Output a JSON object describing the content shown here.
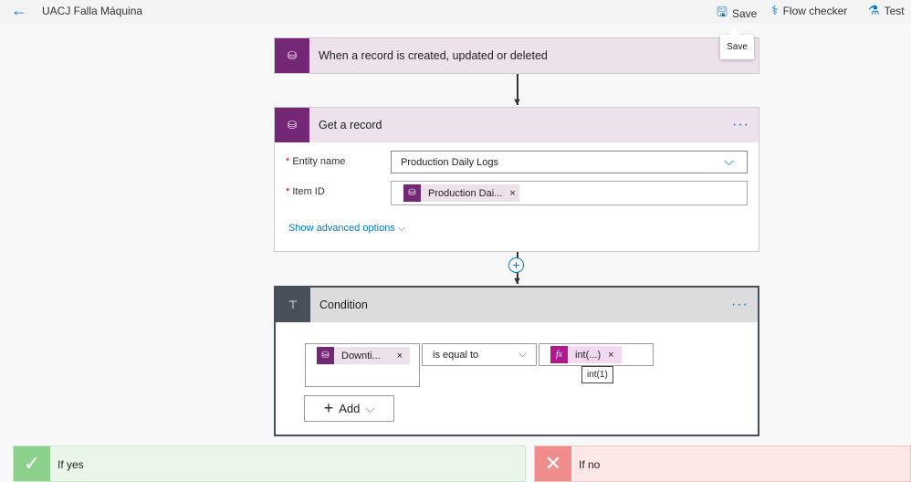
{
  "header": {
    "title": "UACJ Falla Máquina",
    "save": "Save",
    "flow_checker": "Flow checker",
    "test": "Test",
    "tooltip": "Save"
  },
  "trigger": {
    "title": "When a record is created, updated or deleted"
  },
  "get_record": {
    "title": "Get a record",
    "entity_label": "Entity name",
    "entity_value": "Production Daily Logs",
    "item_label": "Item ID",
    "item_token": "Production Dai...",
    "advanced": "Show advanced options"
  },
  "condition": {
    "title": "Condition",
    "left_token": "Downti...",
    "operator": "is equal to",
    "right_token": "int(...)",
    "right_tooltip": "int(1)",
    "add_label": "Add"
  },
  "branches": {
    "yes": "If yes",
    "no": "If no"
  },
  "colors": {
    "accent": "#0078d4",
    "dataverse": "#742774",
    "condition_header": "#484f58"
  }
}
